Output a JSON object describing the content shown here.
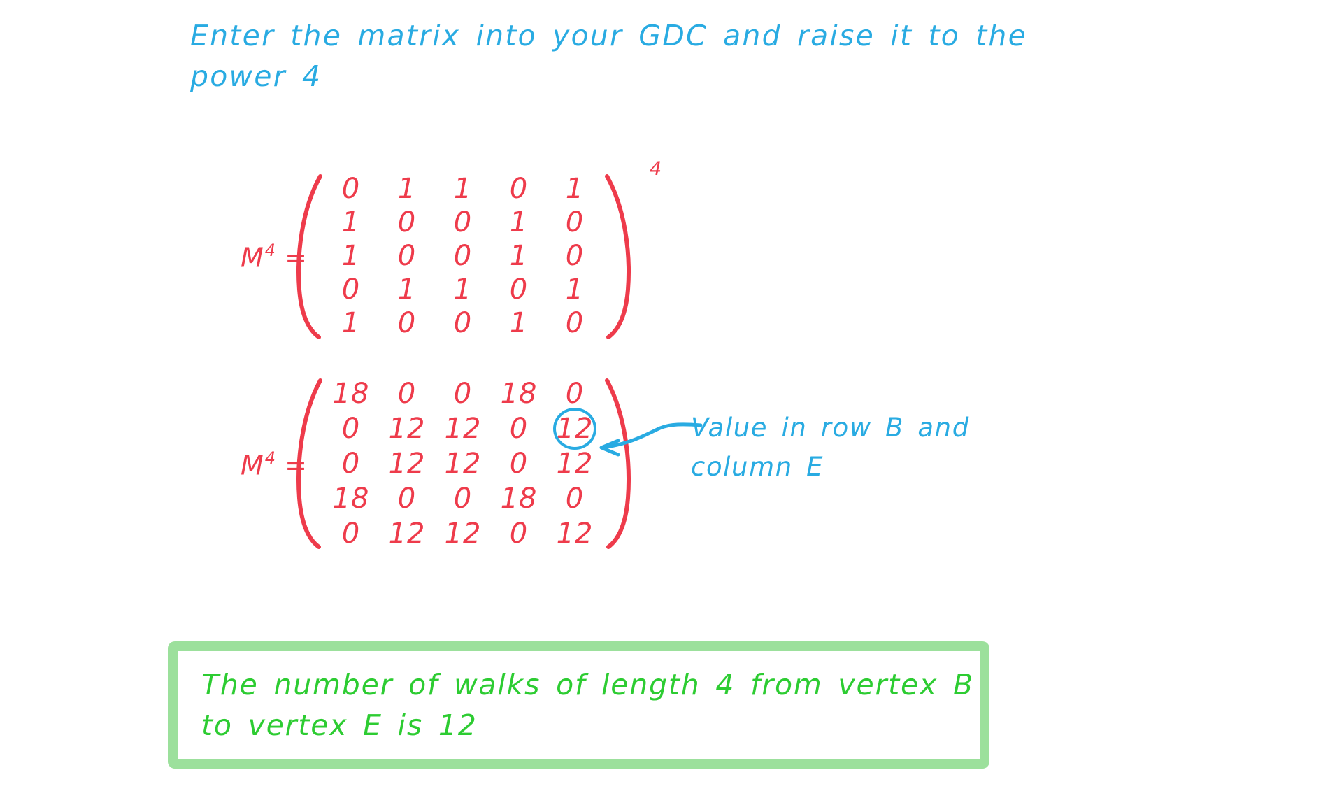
{
  "colors": {
    "instruction_blue": "#29abe2",
    "matrix_red": "#ee3b4b",
    "answer_green": "#2dcc32",
    "answer_box_border": "#9ce09c",
    "highlight_circle": "#29abe2",
    "page_background": "#ffffff"
  },
  "instruction": {
    "line1": "Enter the matrix into your GDC and raise it to the",
    "line2": "power 4"
  },
  "matrix1": {
    "label": "M",
    "label_exponent": "4",
    "equals": "=",
    "exponent_outside": "4",
    "rows": [
      [
        "0",
        "1",
        "1",
        "0",
        "1"
      ],
      [
        "1",
        "0",
        "0",
        "1",
        "0"
      ],
      [
        "1",
        "0",
        "0",
        "1",
        "0"
      ],
      [
        "0",
        "1",
        "1",
        "0",
        "1"
      ],
      [
        "1",
        "0",
        "0",
        "1",
        "0"
      ]
    ]
  },
  "matrix2": {
    "label": "M",
    "label_exponent": "4",
    "equals": "=",
    "rows": [
      [
        "18",
        "0",
        "0",
        "18",
        "0"
      ],
      [
        "0",
        "12",
        "12",
        "0",
        "12"
      ],
      [
        "0",
        "12",
        "12",
        "0",
        "12"
      ],
      [
        "18",
        "0",
        "0",
        "18",
        "0"
      ],
      [
        "0",
        "12",
        "12",
        "0",
        "12"
      ]
    ],
    "highlighted_cell": {
      "row": 1,
      "col": 4,
      "value": "12"
    }
  },
  "annotation": {
    "line1": "Value in row B and",
    "line2": "column E"
  },
  "answer": {
    "line1": "The number of walks of length 4 from vertex B",
    "line2": "to vertex E is 12"
  }
}
